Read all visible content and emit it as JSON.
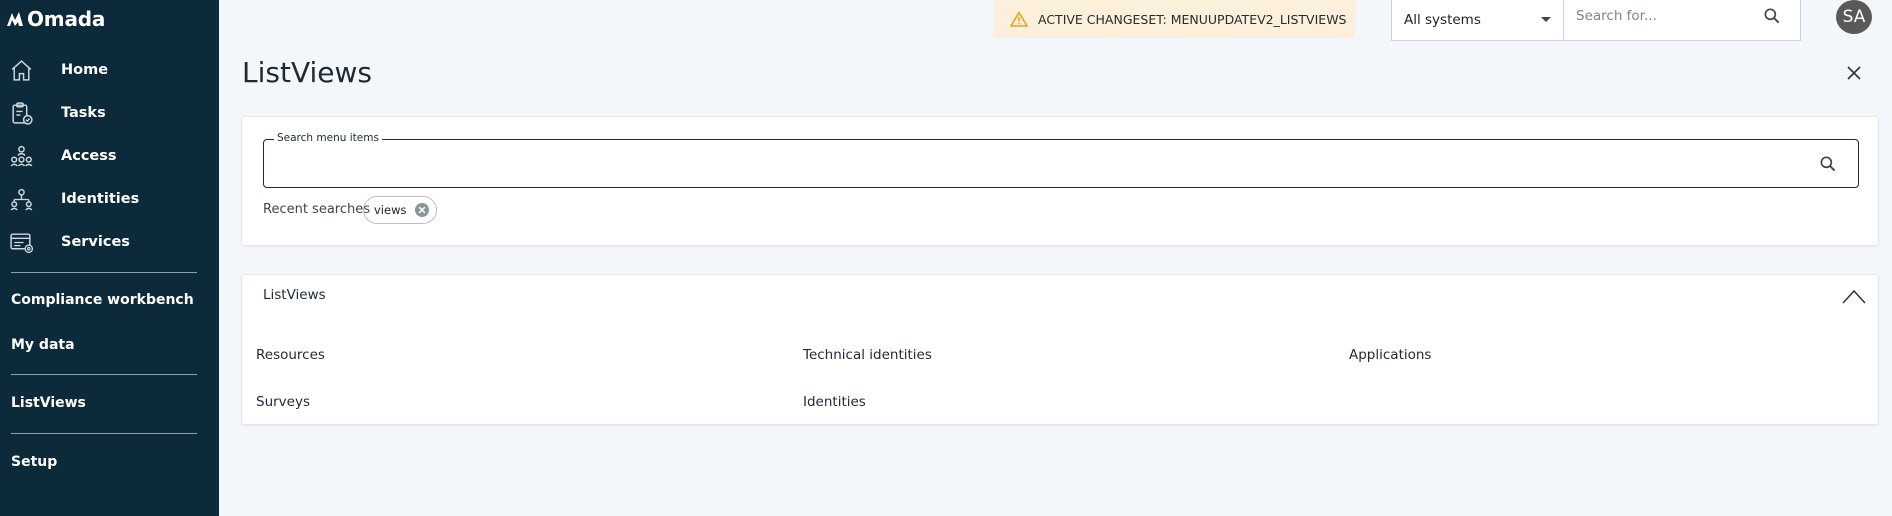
{
  "app": {
    "logo_text": "Omada"
  },
  "sidebar": {
    "items": [
      {
        "label": "Home",
        "icon": "home-icon"
      },
      {
        "label": "Tasks",
        "icon": "tasks-icon"
      },
      {
        "label": "Access",
        "icon": "access-icon"
      },
      {
        "label": "Identities",
        "icon": "identities-icon"
      },
      {
        "label": "Services",
        "icon": "services-icon"
      }
    ],
    "links": [
      {
        "label": "Compliance workbench"
      },
      {
        "label": "My data"
      },
      {
        "label": "ListViews"
      },
      {
        "label": "Setup"
      }
    ]
  },
  "topbar": {
    "changeset_text": "ACTIVE CHANGESET: MENUUPDATEV2_LISTVIEWS",
    "system_select": "All systems",
    "search_placeholder": "Search for...",
    "avatar_initials": "SA"
  },
  "page": {
    "title": "ListViews"
  },
  "menu_search": {
    "label": "Search menu items",
    "value": "",
    "recent_label": "Recent searches",
    "recent": [
      "views"
    ]
  },
  "results": {
    "group_title": "ListViews",
    "items": [
      "Resources",
      "Technical identities",
      "Applications",
      "Surveys",
      "Identities"
    ]
  },
  "colors": {
    "sidebar_bg": "#0c2a3a",
    "changeset_bg": "#fcefdc",
    "warning": "#e8a317",
    "avatar_bg": "#595959"
  }
}
